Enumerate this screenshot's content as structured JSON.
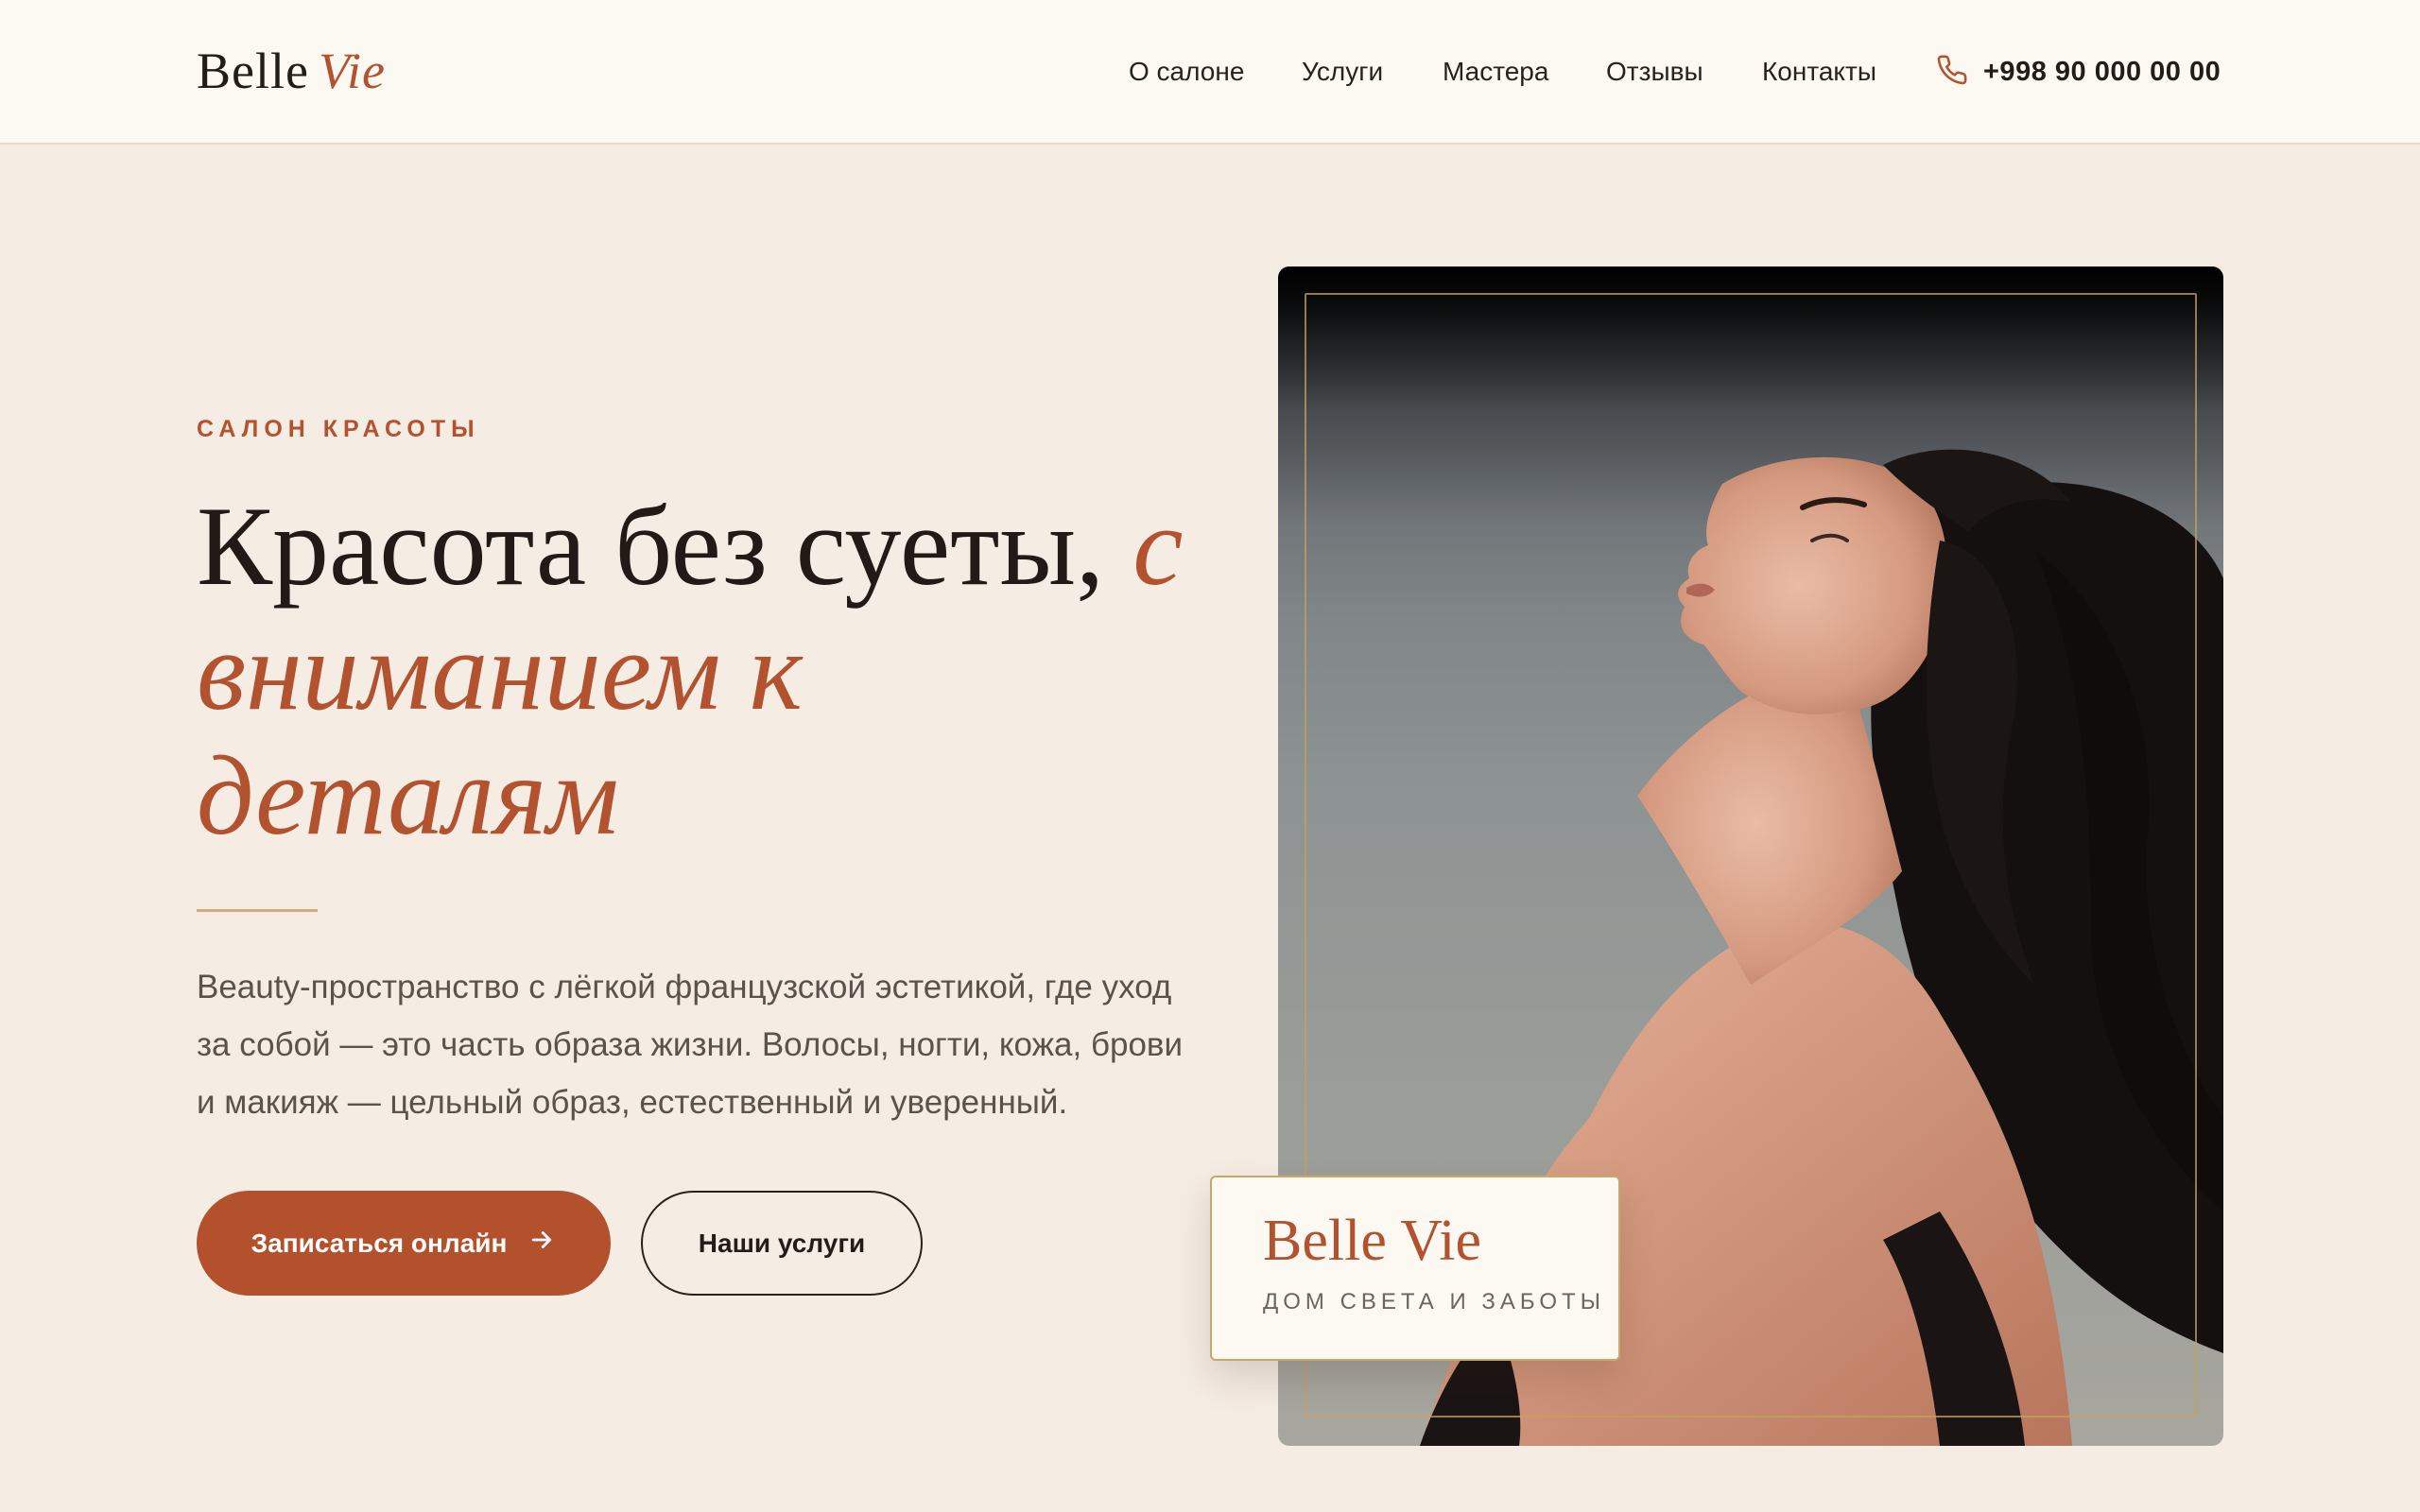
{
  "brand": {
    "name": "Belle",
    "accent": "Vie"
  },
  "nav": {
    "items": [
      "О салоне",
      "Услуги",
      "Мастера",
      "Отзывы",
      "Контакты"
    ],
    "phone": "+998 90 000 00 00",
    "phone_icon": "phone-icon"
  },
  "hero": {
    "eyebrow": "САЛОН КРАСОТЫ",
    "title_main": "Красота без суеты,",
    "title_accent": "с вниманием к деталям",
    "description": "Beauty-пространство с лёгкой французской эстетикой, где уход за собой — это часть образа жизни. Волосы, ногти, кожа, брови и макияж — цельный образ, естественный и уверенный.",
    "primary_button": "Записаться онлайн",
    "secondary_button": "Наши услуги"
  },
  "card": {
    "title": "Belle Vie",
    "subtitle": "ДОМ СВЕТА И ЗАБОТЫ"
  },
  "colors": {
    "accent": "#b4512d",
    "background": "#f5ece4",
    "header_bg": "#fcf9f3",
    "gold": "#c9a766",
    "text": "#231c18"
  }
}
